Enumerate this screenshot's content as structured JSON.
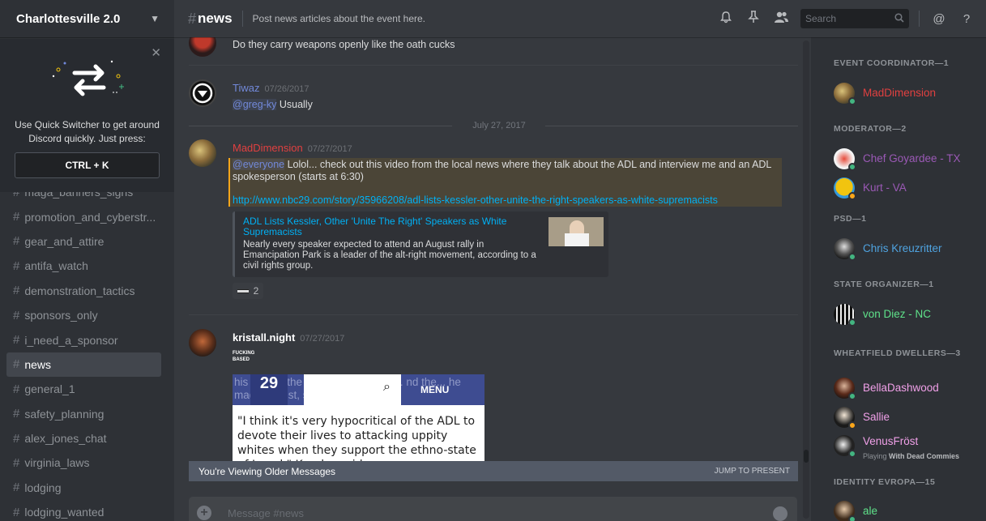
{
  "server": {
    "name": "Charlottesville 2.0"
  },
  "quick_switcher": {
    "text": "Use Quick Switcher to get around Discord quickly. Just press:",
    "shortcut": "CTRL + K",
    "close": "✕"
  },
  "channels": [
    {
      "name": "maga_banners_signs",
      "active": false
    },
    {
      "name": "promotion_and_cyberstr...",
      "active": false
    },
    {
      "name": "gear_and_attire",
      "active": false
    },
    {
      "name": "antifa_watch",
      "active": false
    },
    {
      "name": "demonstration_tactics",
      "active": false
    },
    {
      "name": "sponsors_only",
      "active": false
    },
    {
      "name": "i_need_a_sponsor",
      "active": false
    },
    {
      "name": "news",
      "active": true
    },
    {
      "name": "general_1",
      "active": false
    },
    {
      "name": "safety_planning",
      "active": false
    },
    {
      "name": "alex_jones_chat",
      "active": false
    },
    {
      "name": "virginia_laws",
      "active": false
    },
    {
      "name": "lodging",
      "active": false
    },
    {
      "name": "lodging_wanted",
      "active": false
    }
  ],
  "header": {
    "hash": "#",
    "channel": "news",
    "topic": "Post news articles about the event here.",
    "search_placeholder": "Search",
    "icons": [
      "bell-icon",
      "pin-icon",
      "members-icon",
      "search-icon",
      "mention-icon",
      "help-icon"
    ],
    "mention_glyph": "@",
    "help_glyph": "?"
  },
  "messages": {
    "top_partial": "Do they carry weapons openly like the oath cucks",
    "msg1": {
      "author": "Tiwaz",
      "author_color": "#7289da",
      "time": "07/26/2017",
      "mention": "@greg-ky",
      "text": " Usually"
    },
    "date_divider": "July 27, 2017",
    "msg2": {
      "author": "MadDimension",
      "author_color": "#e04040",
      "time": "07/27/2017",
      "mention": "@everyone",
      "text": " Lolol... check out this video from the local news where they talk about the ADL and interview me and an ADL spokesperson (starts at 6:30)",
      "link": "http://www.nbc29.com/story/35966208/adl-lists-kessler-other-unite-the-right-speakers-as-white-supremacists",
      "embed_title": "ADL Lists Kessler, Other 'Unite The Right' Speakers as White Supremacists",
      "embed_desc": "Nearly every speaker expected to attend an August rally in Emancipation Park is a leader of the alt-right movement, according to a civil rights group.",
      "reaction_count": "2"
    },
    "msg3": {
      "author": "kristall.night",
      "author_color": "#ffffff",
      "time": "07/27/2017",
      "sticker": "FUCKING BASED",
      "img_dim_text": "his ... ry in the orbit of th... group ... nd the... he made our list, said Segal.",
      "img_logo": "29",
      "img_menu": "MENU",
      "img_quote": "\"I think it's very hypocritical of the ADL to devote their lives to attacking uppity whites when they support the ethno-state of Israel,\" Kessler said."
    }
  },
  "older_bar": {
    "text": "You're Viewing Older Messages",
    "jump": "JUMP TO PRESENT"
  },
  "composer": {
    "placeholder": "Message #news",
    "add": "+"
  },
  "members": {
    "roles": [
      {
        "title": "EVENT COORDINATOR—1",
        "members": [
          {
            "name": "MadDimension",
            "color": "#e04040",
            "status": "online"
          }
        ]
      },
      {
        "title": "MODERATOR—2",
        "members": [
          {
            "name": "Chef Goyardee - TX",
            "color": "#9b59b6",
            "status": "online"
          },
          {
            "name": "Kurt - VA",
            "color": "#9b59b6",
            "status": "idle"
          }
        ]
      },
      {
        "title": "PSD—1",
        "members": [
          {
            "name": "Chris Kreuzritter",
            "color": "#4fa3e0",
            "status": "online"
          }
        ]
      },
      {
        "title": "STATE ORGANIZER—1",
        "members": [
          {
            "name": "von Diez - NC",
            "color": "#5fe28a",
            "status": "online"
          }
        ]
      },
      {
        "title": "WHEATFIELD DWELLERS—3",
        "members": [
          {
            "name": "BellaDashwood",
            "color": "#f0a0e8",
            "status": "online"
          },
          {
            "name": "Sallie",
            "color": "#f0a0e8",
            "status": "idle"
          },
          {
            "name": "VenusFröst",
            "color": "#f0a0e8",
            "status": "online",
            "game_prefix": "Playing ",
            "game": "With Dead Commies"
          }
        ]
      },
      {
        "title": "IDENTITY EVROPA—15",
        "members": [
          {
            "name": "ale",
            "color": "#5fe28a",
            "status": "online"
          }
        ]
      }
    ]
  }
}
